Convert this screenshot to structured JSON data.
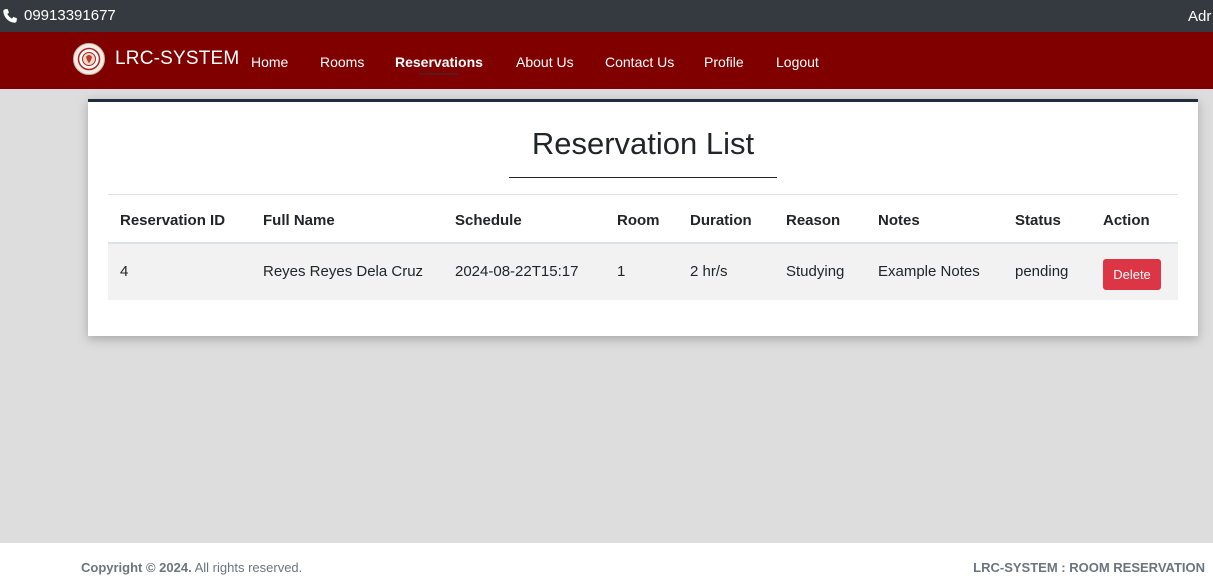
{
  "topbar": {
    "phone_icon": "phone-icon",
    "phone": "09913391677",
    "right_text": "Adr"
  },
  "navbar": {
    "brand": "LRC-SYSTEM",
    "logo_icon": "seal-logo",
    "items": [
      {
        "label": "Home"
      },
      {
        "label": "Rooms"
      },
      {
        "label": "Reservations",
        "active": true
      },
      {
        "label": "About Us"
      },
      {
        "label": "Contact Us"
      },
      {
        "label": "Profile"
      },
      {
        "label": "Logout"
      }
    ]
  },
  "main": {
    "title": "Reservation List",
    "table": {
      "headers": [
        "Reservation ID",
        "Full Name",
        "Schedule",
        "Room",
        "Duration",
        "Reason",
        "Notes",
        "Status",
        "Action"
      ],
      "rows": [
        {
          "id": "4",
          "full_name": "Reyes Reyes Dela Cruz",
          "schedule": "2024-08-22T15:17",
          "room": "1",
          "duration": "2 hr/s",
          "reason": "Studying",
          "notes": "Example Notes",
          "status": "pending",
          "action_label": "Delete"
        }
      ]
    }
  },
  "footer": {
    "copyright_bold": "Copyright © 2024.",
    "copyright_rest": "All rights reserved.",
    "right": "LRC-SYSTEM : ROOM RESERVATION"
  },
  "colors": {
    "topbar": "#343a40",
    "navbar": "#800000",
    "background": "#dddddd",
    "danger": "#dc3545"
  }
}
